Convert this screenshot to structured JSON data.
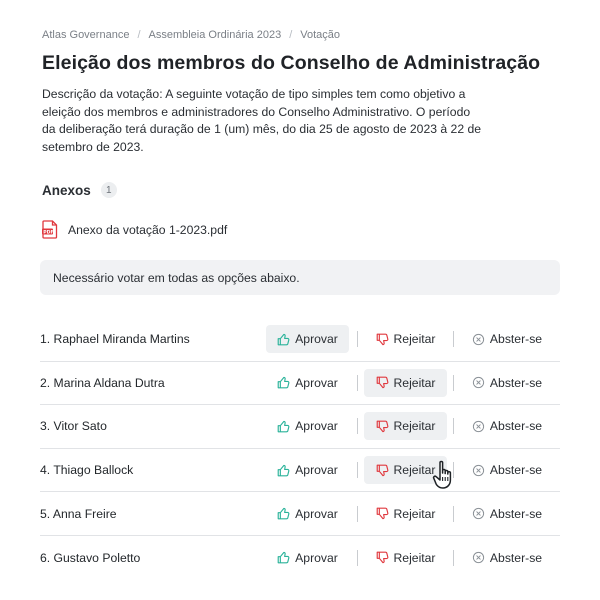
{
  "breadcrumb": {
    "items": [
      "Atlas Governance",
      "Assembleia Ordinária 2023",
      "Votação"
    ],
    "separator": "/"
  },
  "title": "Eleição dos membros do Conselho de Administração",
  "description": "Descrição da votação: A seguinte votação de tipo simples tem como objetivo a eleição dos membros e administradores do Conselho Administrativo. O período da deliberação terá duração de 1 (um) mês, do dia 25 de agosto de 2023 à 22 de setembro de 2023.",
  "annexes": {
    "label": "Anexos",
    "count": "1",
    "files": [
      {
        "name": "Anexo da votação 1-2023.pdf",
        "icon": "pdf-file-icon"
      }
    ]
  },
  "notice": "Necessário votar em todas as opções abaixo.",
  "options": {
    "approve": "Aprovar",
    "reject": "Rejeitar",
    "abstain": "Abster-se"
  },
  "colors": {
    "approve": "#2bb39a",
    "reject": "#e0383e",
    "abstain": "#8a9096",
    "selected_bg": "#eef0f2"
  },
  "candidates": [
    {
      "name": "1. Raphael Miranda Martins",
      "selected": "approve"
    },
    {
      "name": "2. Marina Aldana Dutra",
      "selected": "reject"
    },
    {
      "name": "3. Vitor Sato",
      "selected": "reject"
    },
    {
      "name": "4. Thiago Ballock",
      "selected": "reject"
    },
    {
      "name": "5. Anna Freire",
      "selected": ""
    },
    {
      "name": "6. Gustavo Poletto",
      "selected": ""
    }
  ]
}
